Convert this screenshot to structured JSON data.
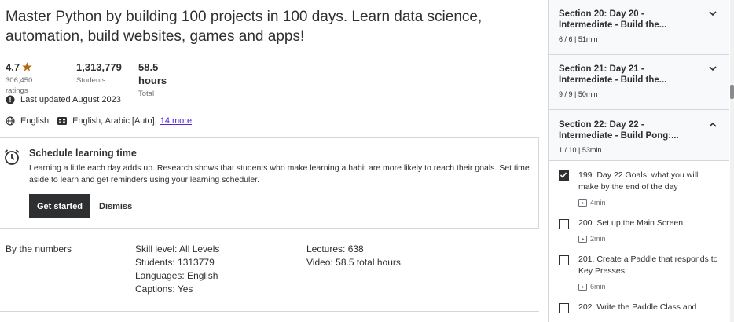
{
  "course": {
    "headline": "Master Python by building 100 projects in 100 days. Learn data science, automation, build websites, games and apps!"
  },
  "stats": {
    "rating": "4.7",
    "ratings_count": "306,450 ratings",
    "students": "1,313,779",
    "students_label": "Students",
    "hours": "58.5 hours",
    "hours_label": "Total"
  },
  "meta": {
    "last_updated": "Last updated August 2023",
    "language": "English",
    "captions": "English, Arabic [Auto],",
    "more_link": "14 more"
  },
  "schedule": {
    "title": "Schedule learning time",
    "text": "Learning a little each day adds up. Research shows that students who make learning a habit are more likely to reach their goals. Set time aside to learn and get reminders using your learning scheduler.",
    "primary_button": "Get started",
    "dismiss_button": "Dismiss"
  },
  "numbers": {
    "heading": "By the numbers",
    "skill_level": "Skill level: All Levels",
    "students": "Students: 1313779",
    "languages": "Languages: English",
    "captions": "Captions: Yes",
    "lectures": "Lectures: 638",
    "video": "Video: 58.5 total hours"
  },
  "sidebar": {
    "sections": [
      {
        "title": "Section 20: Day 20 - Intermediate - Build the...",
        "meta": "6 / 6 | 51min",
        "expanded": false
      },
      {
        "title": "Section 21: Day 21 - Intermediate - Build the...",
        "meta": "9 / 9 | 50min",
        "expanded": false
      },
      {
        "title": "Section 22: Day 22 - Intermediate - Build Pong:...",
        "meta": "1 / 10 | 53min",
        "expanded": true
      }
    ],
    "lectures": [
      {
        "title": "199. Day 22 Goals: what you will make by the end of the day",
        "duration": "4min",
        "checked": true
      },
      {
        "title": "200. Set up the Main Screen",
        "duration": "2min",
        "checked": false
      },
      {
        "title": "201. Create a Paddle that responds to Key Presses",
        "duration": "6min",
        "checked": false
      },
      {
        "title": "202. Write the Paddle Class and",
        "duration": "",
        "checked": false
      }
    ]
  },
  "colors": {
    "text": "#2d2f31",
    "star": "#b4690e",
    "link": "#5624d0",
    "border": "#d1d7dc",
    "section_bg": "#f7f9fa"
  }
}
